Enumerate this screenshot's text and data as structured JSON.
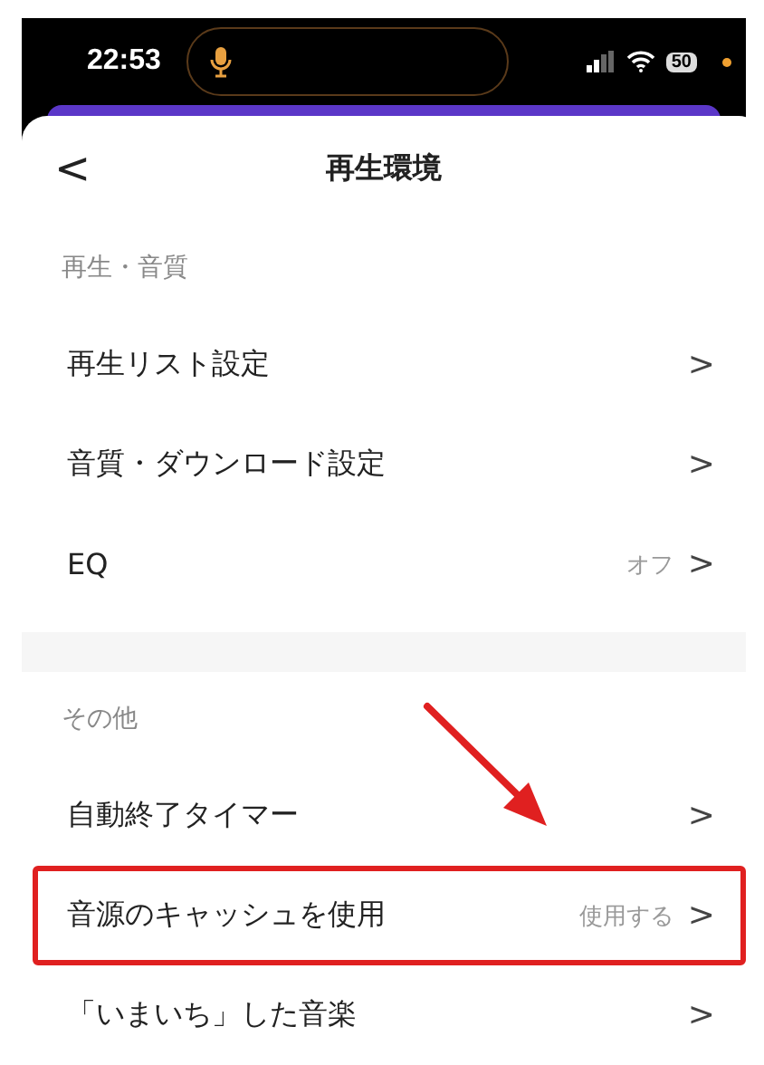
{
  "status_bar": {
    "time": "22:53",
    "battery": "50",
    "mic_active": true
  },
  "header": {
    "back": "<",
    "title": "再生環境"
  },
  "sections": [
    {
      "title": "再生・音質",
      "items": [
        {
          "label": "再生リスト設定",
          "chevron": ">",
          "highlighted": false
        },
        {
          "label": "音質・ダウンロード設定",
          "chevron": ">",
          "highlighted": false
        },
        {
          "label": "EQ",
          "value": "オフ",
          "chevron": ">",
          "highlighted": false
        }
      ]
    },
    {
      "title": "その他",
      "items": [
        {
          "label": "自動終了タイマー",
          "chevron": ">",
          "highlighted": false
        },
        {
          "label": "音源のキャッシュを使用",
          "value": "使用する",
          "chevron": ">",
          "highlighted": true
        },
        {
          "label": "「いまいち」した音楽",
          "chevron": ">",
          "highlighted": false
        }
      ]
    }
  ],
  "annotation": {
    "kind": "arrow"
  }
}
